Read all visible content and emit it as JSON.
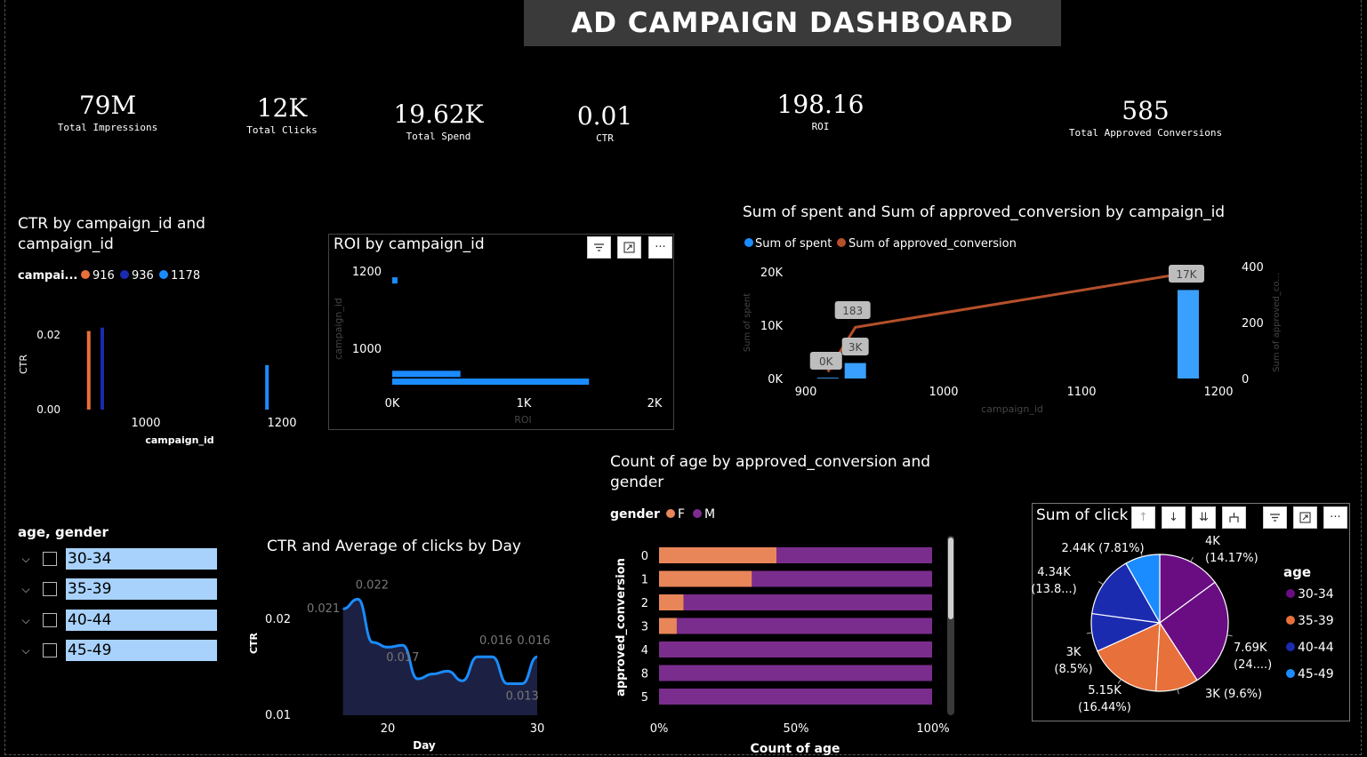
{
  "header": {
    "title": "AD CAMPAIGN DASHBOARD"
  },
  "kpis": [
    {
      "value": "79M",
      "label": "Total Impressions"
    },
    {
      "value": "12K",
      "label": "Total Clicks"
    },
    {
      "value": "19.62K",
      "label": "Total Spend"
    },
    {
      "value": "0.01",
      "label": "CTR"
    },
    {
      "value": "198.16",
      "label": "ROI"
    },
    {
      "value": "585",
      "label": "Total Approved Conversions"
    }
  ],
  "slicer": {
    "title": "age, gender",
    "items": [
      "30-34",
      "35-39",
      "40-44",
      "45-49"
    ]
  },
  "colors": {
    "orange": "#e8703a",
    "navy": "#1b2bb0",
    "blue": "#1a8cff",
    "rust": "#b5502a",
    "purple": "#7b2d8e",
    "salmon": "#e8865a",
    "slicer_bg": "#a8d2fb"
  },
  "chart_data": [
    {
      "id": "ctr_by_campaign",
      "type": "bar",
      "title": "CTR by campaign_id and campaign_id",
      "legend_title": "campai...",
      "legend": [
        "916",
        "936",
        "1178"
      ],
      "x": [
        916,
        936,
        1178
      ],
      "values": [
        0.023,
        0.024,
        0.013
      ],
      "ylabel": "CTR",
      "xlabel": "campaign_id",
      "yticks": [
        "0.00",
        "0.02"
      ],
      "xticks": [
        "1000",
        "1200"
      ],
      "ylim": [
        0,
        0.027
      ]
    },
    {
      "id": "roi_by_campaign",
      "type": "bar",
      "title": "ROI by campaign_id",
      "orientation": "horizontal",
      "ylabel": "campaign_id",
      "xlabel": "ROI",
      "y": [
        916,
        936,
        1178
      ],
      "values": [
        1500,
        520,
        40
      ],
      "xticks": [
        "0K",
        "1K",
        "2K"
      ],
      "yticks": [
        "1000",
        "1200"
      ],
      "xlim": [
        0,
        2000
      ]
    },
    {
      "id": "spent_vs_conversion",
      "type": "bar",
      "title": "Sum of spent and Sum of approved_conversion by campaign_id",
      "legend": [
        "Sum of spent",
        "Sum of approved_conversion"
      ],
      "xlabel": "campaign_id",
      "ylabel": "Sum of spent",
      "y2label": "Sum of approved_co...",
      "x": [
        916,
        936,
        1178
      ],
      "series": [
        {
          "name": "Sum of spent",
          "values": [
            150,
            2900,
            16600
          ],
          "labels": [
            "0K",
            "3K",
            "17K"
          ]
        },
        {
          "name": "Sum of approved_conversion",
          "values": [
            24,
            183,
            378
          ],
          "labels": [
            "183"
          ]
        }
      ],
      "xticks": [
        "900",
        "1000",
        "1100",
        "1200"
      ],
      "yticks": [
        "0K",
        "10K",
        "20K"
      ],
      "y2ticks": [
        "0",
        "200",
        "400"
      ],
      "xlim": [
        900,
        1200
      ],
      "ylim": [
        0,
        21000
      ],
      "y2lim": [
        0,
        420
      ]
    },
    {
      "id": "ctr_by_day",
      "type": "area",
      "title": "CTR and Average of clicks by Day",
      "xlabel": "Day",
      "ylabel": "CTR",
      "x": [
        17,
        18,
        19,
        20,
        21,
        22,
        23,
        24,
        25,
        26,
        27,
        28,
        29,
        30
      ],
      "values": [
        0.021,
        0.022,
        0.0175,
        0.017,
        0.0172,
        0.0137,
        0.0142,
        0.0145,
        0.0135,
        0.016,
        0.016,
        0.0132,
        0.0132,
        0.016
      ],
      "point_labels": [
        {
          "x": 18,
          "label": "0.022"
        },
        {
          "x": 17,
          "label": "0.021"
        },
        {
          "x": 21,
          "label": "0.017"
        },
        {
          "x": 27,
          "label": "0.016"
        },
        {
          "x": 30,
          "label": "0.016"
        },
        {
          "x": 29,
          "label": "0.013"
        }
      ],
      "xticks": [
        "20",
        "30"
      ],
      "yticks": [
        "0.01",
        "0.02"
      ],
      "ylim": [
        0.01,
        0.023
      ]
    },
    {
      "id": "age_by_conversion_gender",
      "type": "bar",
      "title": "Count of age by approved_conversion and gender",
      "stacked": "100%",
      "legend_title": "gender",
      "legend": [
        "F",
        "M"
      ],
      "ylabel": "approved_conversion",
      "xlabel": "Count of age",
      "categories": [
        "0",
        "1",
        "2",
        "3",
        "4",
        "8",
        "5"
      ],
      "series": [
        {
          "name": "F",
          "values": [
            43,
            34,
            9,
            6.5,
            0,
            0,
            0
          ]
        },
        {
          "name": "M",
          "values": [
            57,
            66,
            91,
            93.5,
            100,
            100,
            100
          ]
        }
      ],
      "xticks": [
        "0%",
        "50%",
        "100%"
      ]
    },
    {
      "id": "clicks_by_age",
      "type": "pie",
      "title": "Sum of click",
      "legend_title": "age",
      "legend": [
        "30-34",
        "35-39",
        "40-44",
        "45-49"
      ],
      "labels": [
        {
          "top": "4K",
          "bottom": "(14.17%)"
        },
        {
          "top": "7.69K",
          "bottom": "(24....)"
        },
        {
          "top": "3K (9.6%)",
          "bottom": ""
        },
        {
          "top": "5.15K",
          "bottom": "(16.44%)"
        },
        {
          "top": "3K",
          "bottom": "(8.5%)"
        },
        {
          "top": "4.34K",
          "bottom": "(13.8...)"
        },
        {
          "top": "2.44K (7.81%)",
          "bottom": ""
        }
      ],
      "slices": [
        {
          "name": "30-34",
          "value": 14.17
        },
        {
          "name": "30-34",
          "value": 24.6
        },
        {
          "name": "35-39",
          "value": 9.6
        },
        {
          "name": "35-39",
          "value": 16.44
        },
        {
          "name": "40-44",
          "value": 8.5
        },
        {
          "name": "40-44",
          "value": 13.88
        },
        {
          "name": "45-49",
          "value": 7.81
        }
      ]
    }
  ]
}
